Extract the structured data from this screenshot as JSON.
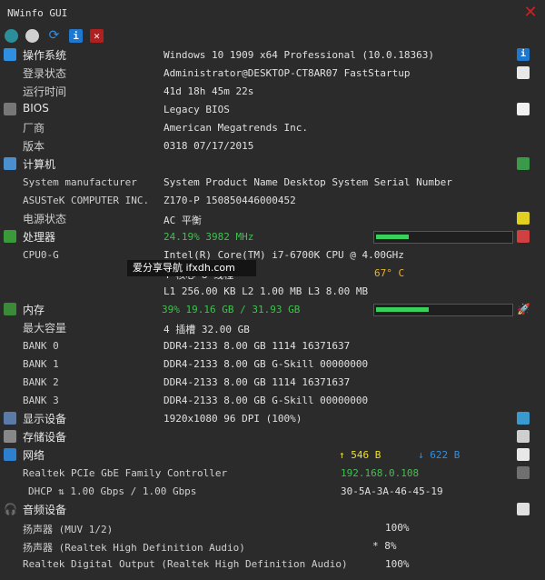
{
  "window": {
    "title": "NWinfo GUI"
  },
  "os": {
    "category": "操作系统",
    "version": "Windows 10 1909 x64 Professional (10.0.18363)",
    "login_label": "登录状态",
    "login_value": "Administrator@DESKTOP-CT8AR07 FastStartup",
    "uptime_label": "运行时间",
    "uptime_value": "41d 18h 45m 22s"
  },
  "bios": {
    "category": "BIOS",
    "type": "Legacy BIOS",
    "vendor_label": "厂商",
    "vendor_value": "American Megatrends Inc.",
    "version_label": "版本",
    "version_value": "0318 07/17/2015"
  },
  "computer": {
    "category": "计算机",
    "system_manufacturer_label": "System manufacturer",
    "system_manufacturer_value": "System Product Name Desktop System Serial Number",
    "board_label": "ASUSTeK COMPUTER INC.",
    "board_value": "Z170-P 150850446000452",
    "power_label": "电源状态",
    "power_value": "AC  平衡"
  },
  "processor": {
    "category": "处理器",
    "usage": "24.19% 3982 MHz",
    "usage_fraction": 0.24,
    "cpu_label": "CPU0-G",
    "cpu_value": "Intel(R) Core(TM) i7-6700K CPU @ 4.00GHz",
    "cores_value": "4 核心 8 线程",
    "temperature": "67° C",
    "cache_value": "L1 256.00 KB L2 1.00 MB L3 8.00 MB"
  },
  "watermark": "爱分享导航 ifxdh.com",
  "memory": {
    "category": "内存",
    "usage": "39% 19.16 GB / 31.93 GB",
    "usage_fraction": 0.39,
    "max_label": "最大容量",
    "max_value": "4 插槽 32.00 GB",
    "banks": [
      {
        "label": "BANK 0",
        "value": "DDR4-2133 8.00 GB 1114 16371637"
      },
      {
        "label": "BANK 1",
        "value": "DDR4-2133 8.00 GB G-Skill 00000000"
      },
      {
        "label": "BANK 2",
        "value": "DDR4-2133 8.00 GB 1114 16371637"
      },
      {
        "label": "BANK 3",
        "value": "DDR4-2133 8.00 GB G-Skill 00000000"
      }
    ]
  },
  "display": {
    "category": "显示设备",
    "value": "1920x1080 96 DPI (100%)"
  },
  "storage": {
    "category": "存储设备"
  },
  "network": {
    "category": "网络",
    "upload": "↑ 546 B",
    "download": "↓ 622 B",
    "adapter_label": "Realtek PCIe GbE Family Controller",
    "ip": "192.168.0.108",
    "dhcp_label": "DHCP ⇅ 1.00 Gbps / 1.00 Gbps",
    "mac": "30-5A-3A-46-45-19"
  },
  "audio": {
    "category": "音频设备",
    "devices": [
      {
        "label": "扬声器 (MUV 1/2)",
        "value": "100%"
      },
      {
        "label": "扬声器 (Realtek High Definition Audio)",
        "value": "* 8%"
      },
      {
        "label": "Realtek Digital Output (Realtek High Definition Audio)",
        "value": "100%"
      }
    ]
  }
}
